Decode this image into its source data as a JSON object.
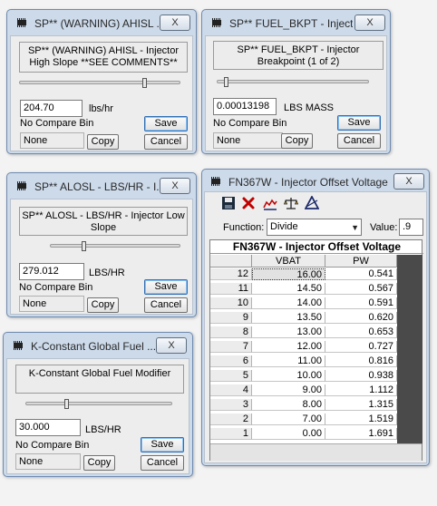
{
  "colors": {
    "titlebar": "#ccdaea",
    "client": "#ededed",
    "table_header_dark": "#4a4a4a",
    "delete_x": "#c00000"
  },
  "win1": {
    "title": "SP** (WARNING) AHISL ...",
    "close_label": "X",
    "description": "SP** (WARNING) AHISL - Injector High Slope **SEE COMMENTS**",
    "value": "204.70",
    "unit": "lbs/hr",
    "compare_label": "No Compare Bin",
    "compare_value": "None",
    "save_label": "Save",
    "copy_label": "Copy",
    "cancel_label": "Cancel"
  },
  "win2": {
    "title": "SP** FUEL_BKPT - Inject...",
    "close_label": "X",
    "description": "SP** FUEL_BKPT - Injector Breakpoint (1 of 2)",
    "value": "0.00013198",
    "unit": "LBS MASS",
    "compare_label": "No Compare Bin",
    "compare_value": "None",
    "save_label": "Save",
    "copy_label": "Copy",
    "cancel_label": "Cancel"
  },
  "win3": {
    "title": "SP** ALOSL - LBS/HR - I...",
    "close_label": "X",
    "description": "SP** ALOSL - LBS/HR - Injector Low Slope",
    "value": "279.012",
    "unit": "LBS/HR",
    "compare_label": "No Compare Bin",
    "compare_value": "None",
    "save_label": "Save",
    "copy_label": "Copy",
    "cancel_label": "Cancel"
  },
  "win4": {
    "title": "K-Constant Global Fuel ...",
    "close_label": "X",
    "description": "K-Constant Global Fuel Modifier",
    "value": "30.000",
    "unit": "LBS/HR",
    "compare_label": "No Compare Bin",
    "compare_value": "None",
    "save_label": "Save",
    "copy_label": "Copy",
    "cancel_label": "Cancel"
  },
  "fn": {
    "title": "FN367W - Injector Offset Voltage",
    "close_label": "X",
    "function_label": "Function:",
    "function_value": "Divide",
    "value_label": "Value:",
    "value_value": ".9",
    "table_title": "FN367W - Injector Offset Voltage",
    "col1": "VBAT",
    "col2": "PW",
    "rows": [
      {
        "i": "12",
        "vbat": "16.00",
        "pw": "0.541"
      },
      {
        "i": "11",
        "vbat": "14.50",
        "pw": "0.567"
      },
      {
        "i": "10",
        "vbat": "14.00",
        "pw": "0.591"
      },
      {
        "i": "9",
        "vbat": "13.50",
        "pw": "0.620"
      },
      {
        "i": "8",
        "vbat": "13.00",
        "pw": "0.653"
      },
      {
        "i": "7",
        "vbat": "12.00",
        "pw": "0.727"
      },
      {
        "i": "6",
        "vbat": "11.00",
        "pw": "0.816"
      },
      {
        "i": "5",
        "vbat": "10.00",
        "pw": "0.938"
      },
      {
        "i": "4",
        "vbat": "9.00",
        "pw": "1.112"
      },
      {
        "i": "3",
        "vbat": "8.00",
        "pw": "1.315"
      },
      {
        "i": "2",
        "vbat": "7.00",
        "pw": "1.519"
      },
      {
        "i": "1",
        "vbat": "0.00",
        "pw": "1.691"
      }
    ]
  }
}
